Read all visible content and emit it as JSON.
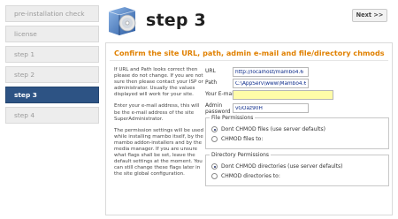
{
  "sidebar": {
    "items": [
      {
        "label": "pre-installation check"
      },
      {
        "label": "license"
      },
      {
        "label": "step 1"
      },
      {
        "label": "step 2"
      },
      {
        "label": "step 3"
      },
      {
        "label": "step 4"
      }
    ],
    "active_index": 4
  },
  "header": {
    "title": "step 3",
    "next_label": "Next >>",
    "logo_icon": "cd-box-icon"
  },
  "main": {
    "subtitle": "Confirm the site URL, path, admin e-mail and file/directory chmods",
    "help": [
      "If URL and Path looks correct then please do not change. If you are not sure then please contact your ISP or administrator. Usually the values displayed will work for your site.",
      "Enter your e-mail address, this will be the e-mail address of the site SuperAdministrator.",
      "The permission settings will be used while installing mambo itself, by the mambo addon-installers and by the media manager. If you are unsure what flags shall be set, leave the default settings at the moment. You can still change these flags later in the site global configuration."
    ],
    "form": {
      "url_label": "URL",
      "url_value": "http://localhost/mambo4.6",
      "path_label": "Path",
      "path_value": "C:\\AppServ\\www\\Mambo4.6",
      "email_label": "Your E-mail",
      "email_value": "",
      "admin_label": "Admin password",
      "admin_value": "vGOaz90H"
    },
    "file_permissions": {
      "legend": "File Permissions",
      "option1": "Dont CHMOD files (use server defaults)",
      "option2": "CHMOD files to:"
    },
    "dir_permissions": {
      "legend": "Directory Permissions",
      "option1": "Dont CHMOD directories (use server defaults)",
      "option2": "CHMOD directories to:"
    }
  },
  "colors": {
    "active_step": "#2d5384",
    "subtitle": "#e08000",
    "email_highlight": "#fffca8"
  }
}
